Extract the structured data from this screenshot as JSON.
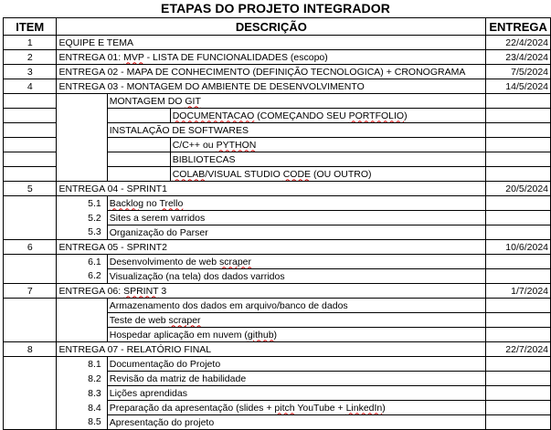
{
  "title": "ETAPAS DO PROJETO INTEGRADOR",
  "headers": {
    "item": "ITEM",
    "descricao": "DESCRIÇÃO",
    "entrega": "ENTREGA"
  },
  "rows": {
    "r1": {
      "item": "1",
      "text": "EQUIPE E TEMA",
      "date": "22/4/2024"
    },
    "r2": {
      "item": "2",
      "text_pre": "ENTREGA 01: ",
      "text_mvp": "MVP",
      "text_post": " -  LISTA DE FUNCIONALIDADES (escopo)",
      "date": "23/4/2024"
    },
    "r3": {
      "item": "3",
      "text": "ENTREGA 02 - MAPA DE CONHECIMENTO (DEFINIÇÃO TECNOLOGICA) + CRONOGRAMA",
      "date": "7/5/2024"
    },
    "r4": {
      "item": "4",
      "text": "ENTREGA 03 - MONTAGEM DO AMBIENTE DE DESENVOLVIMENTO",
      "date": "14/5/2024"
    },
    "r4a": {
      "text_pre": "MONTAGEM DO ",
      "text_git": "GIT"
    },
    "r4b": {
      "text_doc": "DOCUMENTACAO",
      "text_mid": " (COMEÇANDO SEU ",
      "text_port": "PORTFOLIO",
      "text_end": ")"
    },
    "r4c": {
      "text": "INSTALAÇÃO DE SOFTWARES"
    },
    "r4d": {
      "text_pre": "C/C++ ou ",
      "text_py": "PYTHON"
    },
    "r4e": {
      "text": "BIBLIOTECAS"
    },
    "r4f": {
      "text_colab": "COLAB",
      "text_mid": "/VISUAL STUDIO ",
      "text_code": "CODE",
      "text_end": " (OU OUTRO)"
    },
    "r5": {
      "item": "5",
      "text": "ENTREGA 04 - SPRINT1",
      "date": "20/5/2024"
    },
    "r51": {
      "item": "5.1",
      "text_back": "Backlog",
      "text_mid": " no ",
      "text_trello": "Trello"
    },
    "r52": {
      "item": "5.2",
      "text": "Sites a serem varridos"
    },
    "r53": {
      "item": "5.3",
      "text": "Organização do Parser"
    },
    "r6": {
      "item": "6",
      "text": "ENTREGA 05 - SPRINT2",
      "date": "10/6/2024"
    },
    "r61": {
      "item": "6.1",
      "text_pre": "Desenvolvimento de web ",
      "text_scr": "scraper"
    },
    "r62": {
      "item": "6.2",
      "text": "Visualização (na tela) dos dados varridos"
    },
    "r7": {
      "item": "7",
      "text_pre": "ENTREGA 06: ",
      "text_sprint": "SPRINT",
      "text_post": " 3",
      "date": "1/7/2024"
    },
    "r7a": {
      "text": "Armazenamento dos dados em arquivo/banco de dados"
    },
    "r7b": {
      "text_pre": "Teste de web ",
      "text_scr": "scraper"
    },
    "r7c": {
      "text_pre": "Hospedar aplicação em nuvem (",
      "text_gh": "github",
      "text_end": ")"
    },
    "r8": {
      "item": "8",
      "text": "ENTREGA 07 - RELATÓRIO FINAL",
      "date": "22/7/2024"
    },
    "r81": {
      "item": "8.1",
      "text": "Documentação do Projeto"
    },
    "r82": {
      "item": "8.2",
      "text": "Revisão da matriz de habilidade"
    },
    "r83": {
      "item": "8.3",
      "text": "Lições aprendidas"
    },
    "r84": {
      "item": "8.4",
      "text_pre": "Preparação da apresentação (slides + ",
      "text_pitch": "pitch",
      "text_mid": " YouTube + ",
      "text_li": "LinkedIn",
      "text_end": ")"
    },
    "r85": {
      "item": "8.5",
      "text": "Apresentação do projeto"
    }
  }
}
